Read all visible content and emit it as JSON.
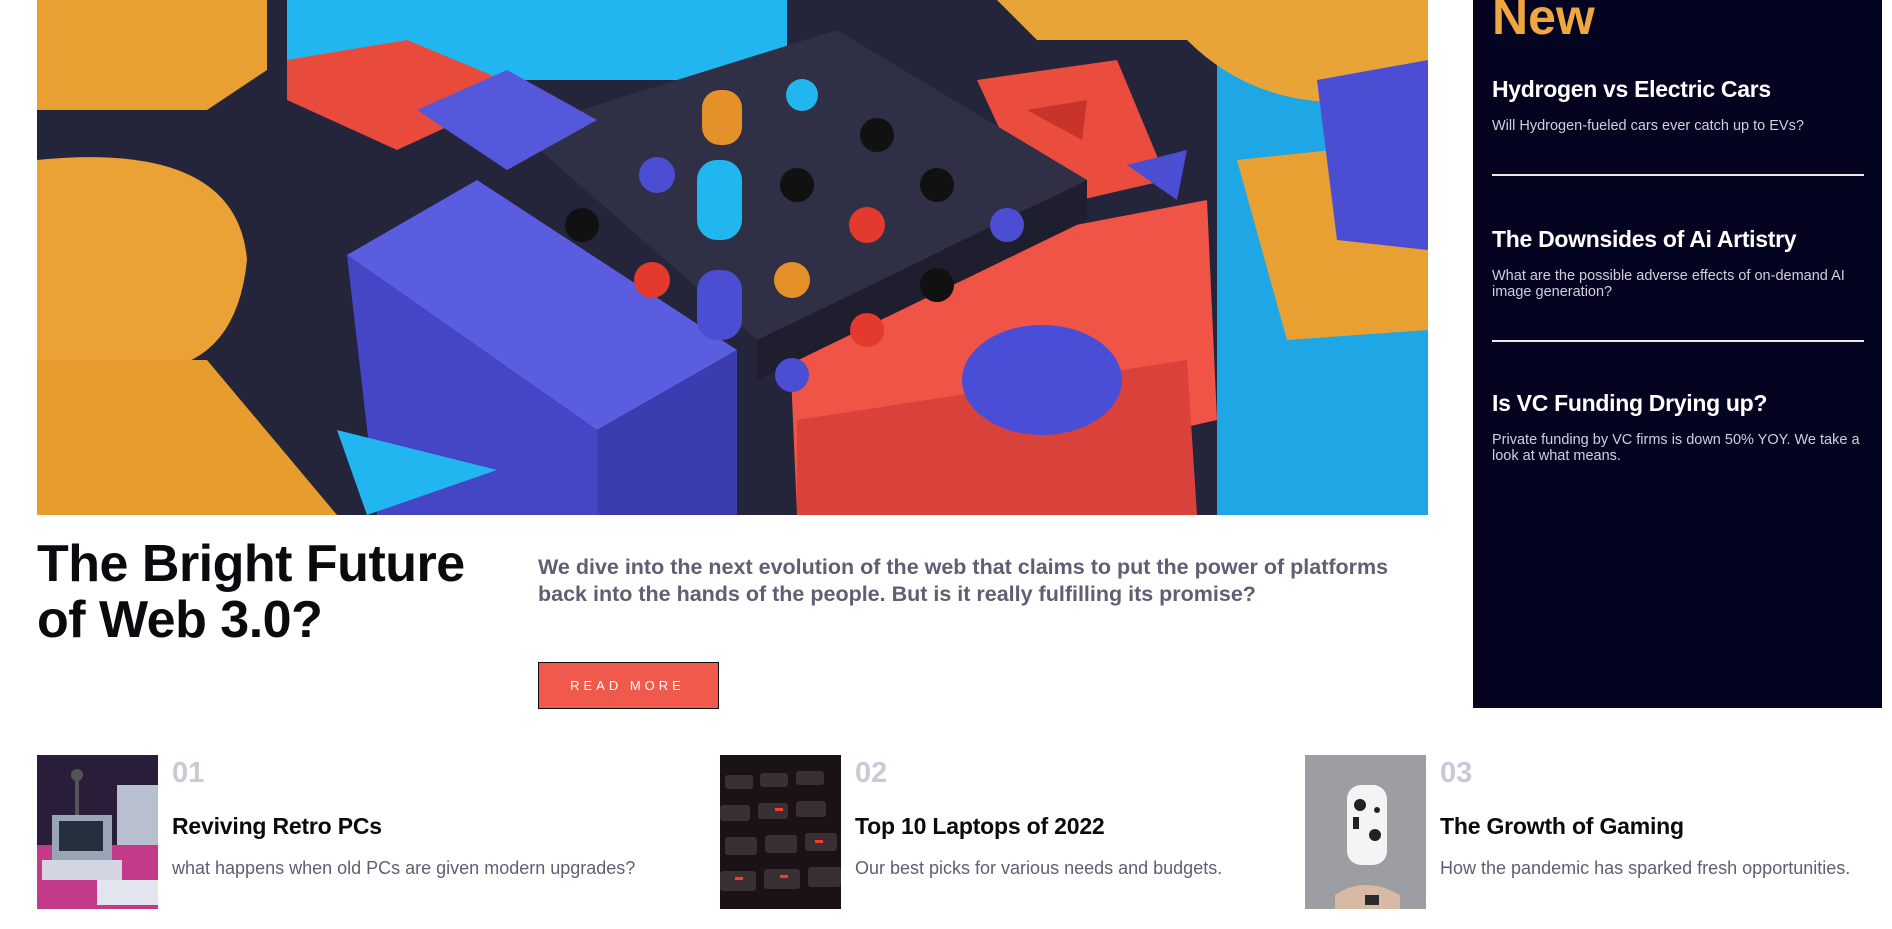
{
  "hero": {
    "image_alt": "abstract colorful 3D geometric blocks",
    "title": "The Bright Future of Web 3.0?",
    "lead": "We dive into the next evolution of the web that claims to put the power of platforms back into the hands of the people. But is it really fulfilling its promise?",
    "read_more_label": "READ MORE"
  },
  "sidebar": {
    "title": "New",
    "items": [
      {
        "title": "Hydrogen vs Electric Cars",
        "desc": "Will Hydrogen-fueled cars ever catch up to EVs?"
      },
      {
        "title": "The Downsides of Ai Artistry",
        "desc": "What are the possible adverse effects of on-demand AI image generation?"
      },
      {
        "title": "Is VC Funding Drying up?",
        "desc": "Private funding by VC firms is down 50% YOY. We take a look at what means."
      }
    ]
  },
  "cards": [
    {
      "number": "01",
      "title": "Reviving Retro PCs",
      "desc": "what happens when old PCs are given modern upgrades?",
      "image": "retro-pc-image"
    },
    {
      "number": "02",
      "title": "Top 10 Laptops of 2022",
      "desc": "Our best picks for various needs and budgets.",
      "image": "laptop-keyboard-image"
    },
    {
      "number": "03",
      "title": "The Growth of Gaming",
      "desc": "How the pandemic has sparked fresh opportunities.",
      "image": "game-controller-image"
    }
  ],
  "colors": {
    "accent_orange": "#f1a73f",
    "accent_red": "#ef5a4d",
    "sidebar_bg": "#040320",
    "muted_text": "#5e5f73",
    "number_gray": "#c9cad6"
  }
}
